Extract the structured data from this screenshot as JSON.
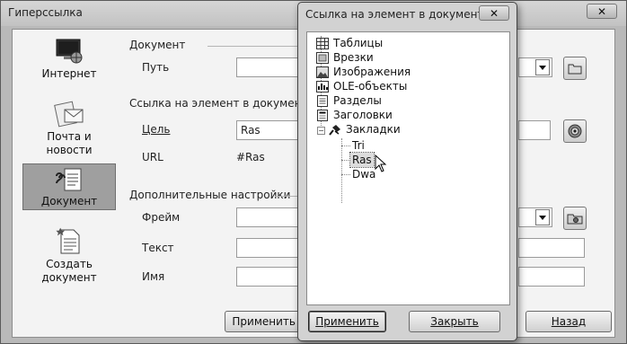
{
  "window": {
    "title": "Гиперссылка",
    "close_glyph": "✕"
  },
  "sidebar": {
    "items": [
      {
        "label": "Интернет",
        "icon": "internet-icon"
      },
      {
        "label": "Почта и новости",
        "icon": "mail-icon"
      },
      {
        "label": "Документ",
        "icon": "document-icon",
        "selected": true
      },
      {
        "label": "Создать документ",
        "icon": "new-document-icon"
      }
    ]
  },
  "document_section": {
    "title": "Документ",
    "path_label": "Путь",
    "path_value": ""
  },
  "target_section": {
    "title": "Ссылка на элемент в документе",
    "target_label": "Цель",
    "target_value": "Ras",
    "url_label": "URL",
    "url_value": "#Ras"
  },
  "extra_section": {
    "title": "Дополнительные настройки",
    "frame_label": "Фрейм",
    "frame_value": "",
    "text_label": "Текст",
    "text_value": "",
    "name_label": "Имя",
    "name_value": ""
  },
  "main_buttons": {
    "apply": "Применить",
    "back": "Назад"
  },
  "dialog": {
    "title": "Ссылка на элемент в документе",
    "close_glyph": "✕",
    "tree": [
      {
        "label": "Таблицы",
        "icon": "table-icon"
      },
      {
        "label": "Врезки",
        "icon": "frame-icon"
      },
      {
        "label": "Изображения",
        "icon": "image-icon"
      },
      {
        "label": "OLE-объекты",
        "icon": "ole-object-icon"
      },
      {
        "label": "Разделы",
        "icon": "section-icon"
      },
      {
        "label": "Заголовки",
        "icon": "heading-icon"
      },
      {
        "label": "Закладки",
        "icon": "bookmark-icon",
        "expanded": true
      }
    ],
    "bookmarks": [
      "Tri",
      "Ras",
      "Dwa"
    ],
    "selected_bookmark": "Ras",
    "apply": "Применить",
    "close": "Закрыть"
  }
}
